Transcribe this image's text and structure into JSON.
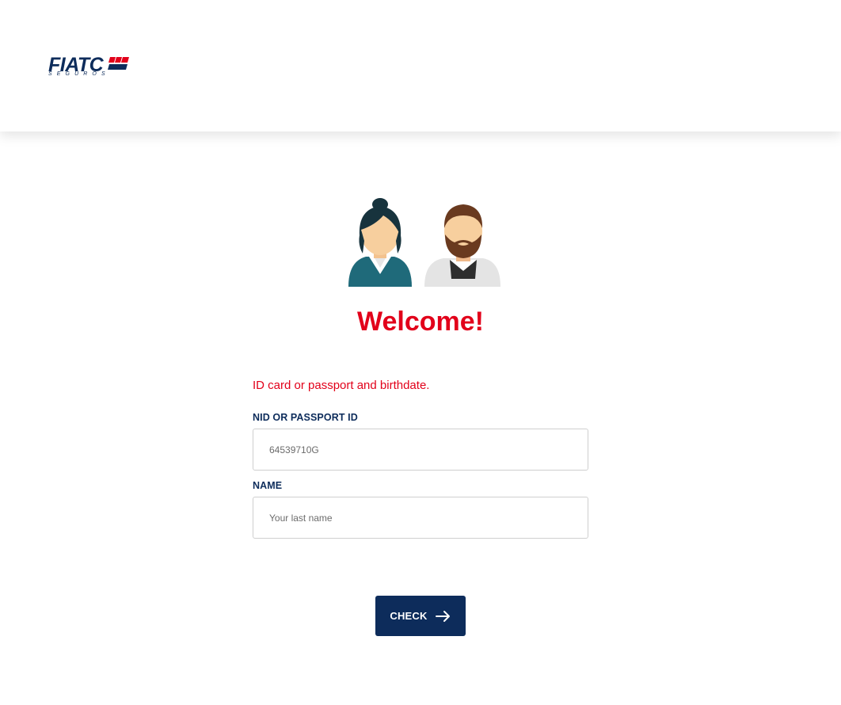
{
  "brand": {
    "name": "FIATC",
    "tagline": "SEGUROS",
    "primary_color": "#0d2c5b",
    "accent_color": "#e2001a"
  },
  "hero": {
    "image": "user-avatars-illustration",
    "title": "Welcome!"
  },
  "form": {
    "intro": "ID card or passport and birthdate.",
    "nid": {
      "label": "NID OR PASSPORT ID",
      "placeholder": "64539710G",
      "value": ""
    },
    "name": {
      "label": "NAME",
      "placeholder": "Your last name",
      "value": ""
    }
  },
  "actions": {
    "check_label": "CHECK",
    "check_icon": "arrow-right-icon"
  }
}
